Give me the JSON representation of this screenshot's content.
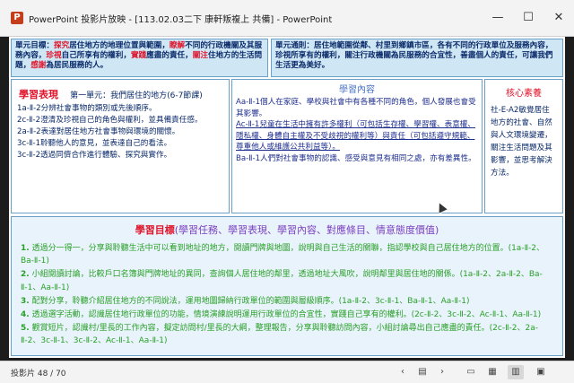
{
  "window": {
    "app_icon": "P",
    "title": "PowerPoint 投影片放映 - [113.02.03二下 康軒叛複上 共備] - PowerPoint",
    "minimize": "—",
    "maximize": "☐",
    "close": "✕"
  },
  "unit_goal": {
    "label": "單元目標：",
    "parts": [
      "探究",
      "居住地方的地理位置與範圍，",
      "瞭解",
      "不同的行政機關及其服務內容，",
      "珍視",
      "自己所享有的權利，",
      "實踐",
      "應盡的責任，",
      "關注",
      "住地方的生活問題，",
      "感謝",
      "為居民服務的人。"
    ]
  },
  "rule": {
    "text": "單元通則：居住地範圍從鄰、村里到鄉鎮市區，各有不同的行政單位及服務內容，珍視所享有的權利，關注行政機關為民服務的合宜性，善盡個人的責任，可讓我們生活更為美好。"
  },
  "performance": {
    "title": "學習表現",
    "unit_title": "第一單元：我們居住的地方(6-7節課)",
    "items": [
      "1a-Ⅱ-2分辨社會事物的類別或先後順序。",
      "2c-Ⅱ-2澄清及珍視自己的角色與權利，並具備責任感。",
      "2a-Ⅱ-2表達對居住地方社會事物與環境的關懷。",
      "3c-Ⅱ-1聆聽他人的意見，並表達自己的看法。",
      "3c-Ⅱ-2透過同儕合作進行體驗、探究與實作。"
    ]
  },
  "content": {
    "title": "學習內容",
    "items": [
      "Aa-Ⅱ-1個人在家庭、學校與社會中有各種不同的角色，個人發展也會受其影響。",
      "Ac-Ⅱ-1兒童在生活中擁有許多權利（可包括生存權、學習權、表意權、隱私權、身體自主權及不受歧視的權利等）與責任（可包括遵守規範、尊重他人或維護公共利益等）。",
      "Ba-Ⅱ-1人們對社會事物的認識、感受與意見有相同之處，亦有差異性。"
    ]
  },
  "core": {
    "title": "核心素養",
    "text": "社-E-A2敏覺居住地方的社會、自然與人文環境變遷，關注生活問題及其影響，並思考解決方法。"
  },
  "goals": {
    "title": "學習目標",
    "subtitle": "(學習任務、學習表現、學習內容、對應條目、情意態度價值)",
    "items": [
      {
        "num": "1.",
        "text": "透過分一得一，分享與聆聽生活中可以看到地址的地方，閱讀門牌與地圖，說明與自己生活的關聯，指認學校與自己居住地方的位置。(1a-Ⅱ-2、Ba-Ⅱ-1)"
      },
      {
        "num": "2.",
        "text": "小組閱讀討論，比較戶口名簿與門牌地址的異同，查詢個人居住地的鄰里，透過地址大風吹，說明鄰里與居住地的關係。(1a-Ⅱ-2、2a-Ⅱ-2、Ba-Ⅱ-1、Aa-Ⅱ-1)"
      },
      {
        "num": "3.",
        "text": "配對分享，聆聽介紹居住地方的不同說法，運用地圖歸納行政單位的範圍與層級順序。(1a-Ⅱ-2、3c-Ⅱ-1、Ba-Ⅱ-1、Aa-Ⅱ-1)"
      },
      {
        "num": "4.",
        "text": "透過選字活動，認識居住地行政單位的功能，情境演練說明運用行政單位的合宜性，實踐自己享有的權利。(2c-Ⅱ-2、3c-Ⅱ-2、Ac-Ⅱ-1、Aa-Ⅱ-1)"
      },
      {
        "num": "5.",
        "text": "觀賞短片，認識村/里長的工作內容，擬定訪問村/里長的大綱，整理報告，分享與聆聽訪問內容，小組討論尋出自己應盡的責任。(2c-Ⅱ-2、2a-Ⅱ-2、3c-Ⅱ-1、3c-Ⅱ-2、Ac-Ⅱ-1、Aa-Ⅱ-1)"
      }
    ]
  },
  "status": {
    "slide_count": "投影片 48 / 70",
    "buttons": [
      "‹",
      "▤",
      "›",
      "▭",
      "▦",
      "▥",
      "▣"
    ]
  }
}
